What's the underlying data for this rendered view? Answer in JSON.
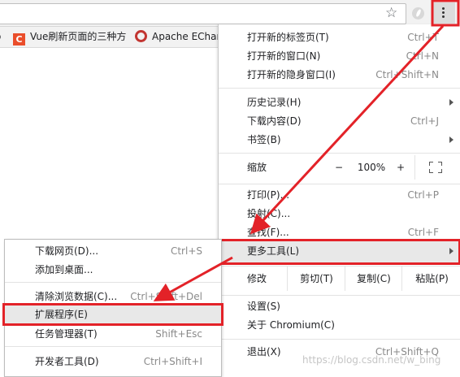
{
  "toolbar": {
    "star_icon": "star-icon",
    "extension_icon": "extension-icon",
    "menu_icon": "vertical-dots-icon"
  },
  "bookmarks": [
    {
      "label": "Vue刷新页面的三种方",
      "icon": "csdn-favicon",
      "icon_text": "C"
    },
    {
      "label": "Apache EChar",
      "icon": "echarts-favicon"
    }
  ],
  "main_menu": {
    "new_tab": {
      "label": "打开新的标签页(T)",
      "shortcut": "Ctrl+T"
    },
    "new_window": {
      "label": "打开新的窗口(N)",
      "shortcut": "Ctrl+N"
    },
    "new_incognito": {
      "label": "打开新的隐身窗口(I)",
      "shortcut": "Ctrl+Shift+N"
    },
    "history": {
      "label": "历史记录(H)"
    },
    "downloads": {
      "label": "下载内容(D)",
      "shortcut": "Ctrl+J"
    },
    "bookmarks": {
      "label": "书签(B)"
    },
    "zoom": {
      "label": "缩放",
      "minus": "−",
      "value": "100%",
      "plus": "+"
    },
    "print": {
      "label": "打印(P)...",
      "shortcut": "Ctrl+P"
    },
    "cast": {
      "label": "投射(C)..."
    },
    "find": {
      "label": "查找(F)...",
      "shortcut": "Ctrl+F"
    },
    "more_tools": {
      "label": "更多工具(L)"
    },
    "edit": {
      "label": "修改",
      "cut": "剪切(T)",
      "copy": "复制(C)",
      "paste": "粘贴(P)"
    },
    "settings": {
      "label": "设置(S)"
    },
    "about": {
      "label": "关于 Chromium(C)"
    },
    "exit": {
      "label": "退出(X)",
      "shortcut": "Ctrl+Shift+Q"
    }
  },
  "sub_menu": {
    "save_page": {
      "label": "下载网页(D)...",
      "shortcut": "Ctrl+S"
    },
    "add_to_desktop": {
      "label": "添加到桌面..."
    },
    "clear_data": {
      "label": "清除浏览数据(C)...",
      "shortcut": "Ctrl+Shift+Del"
    },
    "extensions": {
      "label": "扩展程序(E)"
    },
    "task_manager": {
      "label": "任务管理器(T)",
      "shortcut": "Shift+Esc"
    },
    "dev_tools": {
      "label": "开发者工具(D)",
      "shortcut": "Ctrl+Shift+I"
    }
  },
  "watermark": "https://blog.csdn.net/w_bing",
  "colors": {
    "highlight": "#e32228",
    "hover_bg": "#e8e8e8"
  }
}
